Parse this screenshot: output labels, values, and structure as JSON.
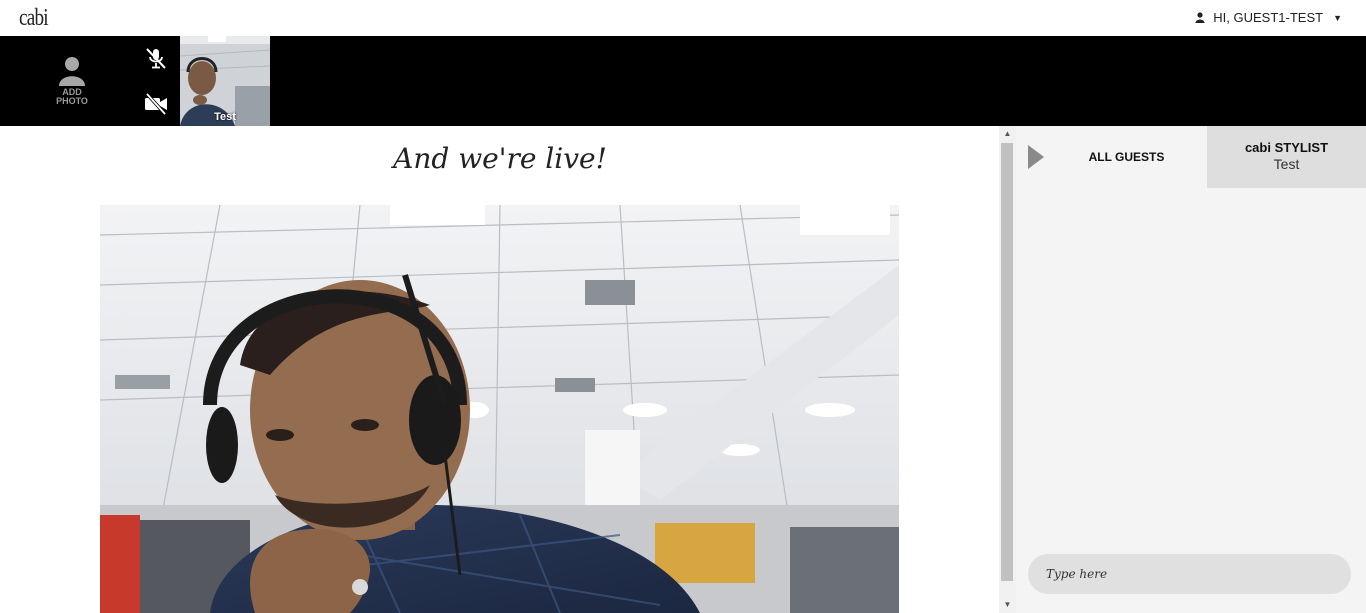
{
  "header": {
    "logo_text": "cabi",
    "user_label": "HI, GUEST1-TEST"
  },
  "participants": {
    "add_photo_label": "ADD\nPHOTO",
    "mic_state": "muted",
    "camera_state": "off",
    "self_name": "Test"
  },
  "main": {
    "headline": "And we're live!"
  },
  "chat": {
    "tab_all_label": "ALL GUESTS",
    "tab_stylist_title": "cabi STYLIST",
    "tab_stylist_name": "Test",
    "input_placeholder": "Type here"
  },
  "colors": {
    "strip_bg": "#000000",
    "panel_bg": "#f4f4f4",
    "tab_inactive_bg": "#dedede"
  }
}
